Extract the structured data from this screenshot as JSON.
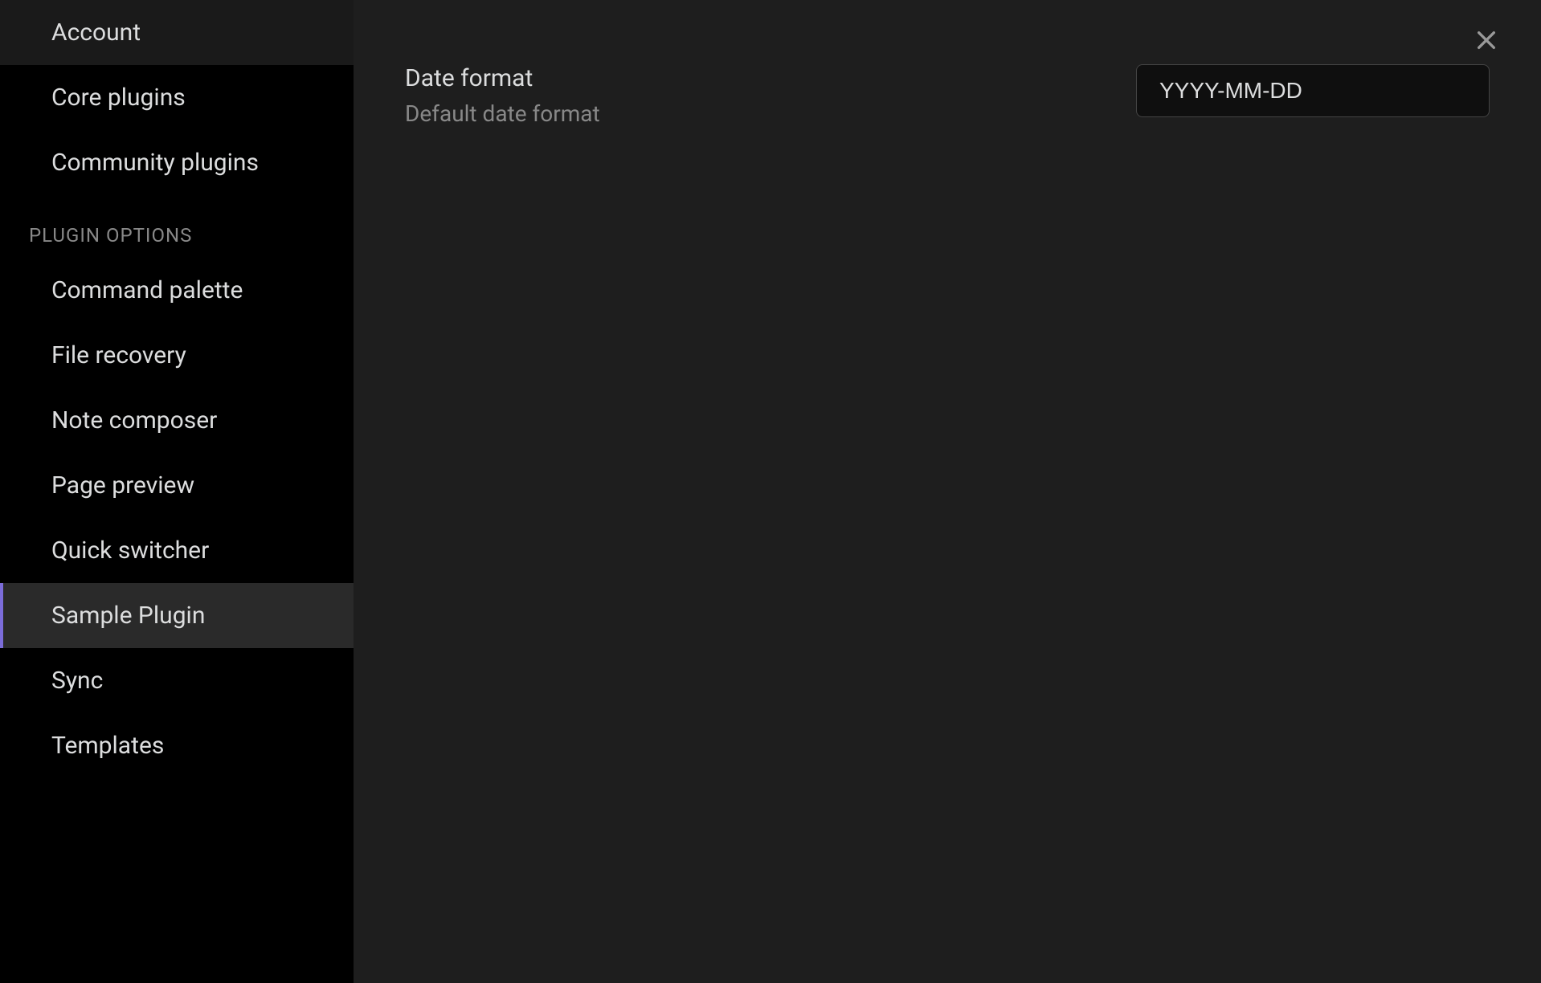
{
  "sidebar": {
    "top_items": [
      {
        "label": "Account"
      },
      {
        "label": "Core plugins"
      },
      {
        "label": "Community plugins"
      }
    ],
    "section_header": "PLUGIN OPTIONS",
    "plugin_items": [
      {
        "label": "Command palette"
      },
      {
        "label": "File recovery"
      },
      {
        "label": "Note composer"
      },
      {
        "label": "Page preview"
      },
      {
        "label": "Quick switcher"
      },
      {
        "label": "Sample Plugin",
        "active": true
      },
      {
        "label": "Sync"
      },
      {
        "label": "Templates"
      }
    ]
  },
  "content": {
    "setting": {
      "title": "Date format",
      "description": "Default date format",
      "value": "YYYY-MM-DD"
    }
  }
}
